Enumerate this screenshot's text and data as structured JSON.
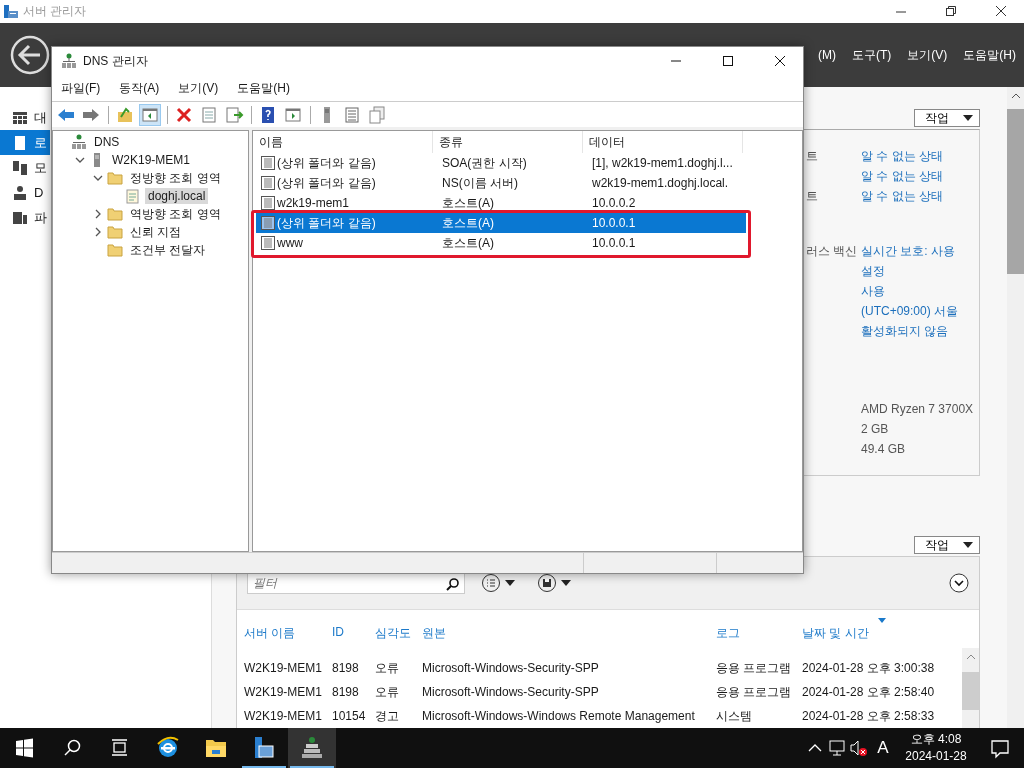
{
  "server_manager": {
    "title": "서버 관리자",
    "menu": [
      "(M)",
      "도구(T)",
      "보기(V)",
      "도움말(H)"
    ],
    "nav": [
      {
        "label": "대",
        "kind": "dashboard",
        "selected": false
      },
      {
        "label": "로",
        "kind": "local",
        "selected": true
      },
      {
        "label": "모",
        "kind": "all",
        "selected": false
      },
      {
        "label": "D",
        "kind": "dns",
        "selected": false
      },
      {
        "label": "파",
        "kind": "files",
        "selected": false
      }
    ],
    "properties": {
      "tasks_button": "작업",
      "groups": [
        [
          {
            "label": "트",
            "value": "알 수 없는 상태",
            "kind": "link"
          },
          {
            "value": "알 수 없는 상태",
            "kind": "link"
          },
          {
            "label": "트",
            "value": "알 수 없는 상태",
            "kind": "link"
          }
        ],
        [
          {
            "label": "러스 백신",
            "value": "실시간 보호: 사용",
            "kind": "link"
          },
          {
            "value": "설정",
            "kind": "link"
          },
          {
            "value": "사용",
            "kind": "link"
          },
          {
            "value": "(UTC+09:00) 서울",
            "kind": "link"
          },
          {
            "value": "활성화되지 않음",
            "kind": "link"
          }
        ],
        [
          {
            "value": "AMD Ryzen 7 3700X",
            "kind": "text"
          },
          {
            "value": "2 GB",
            "kind": "text"
          },
          {
            "value": "49.4 GB",
            "kind": "text"
          }
        ]
      ]
    },
    "events": {
      "tasks_button": "작업",
      "filter": {
        "placeholder": "필터"
      },
      "columns": [
        {
          "label": "서버 이름",
          "sorted": false
        },
        {
          "label": "ID",
          "sorted": false
        },
        {
          "label": "심각도",
          "sorted": false
        },
        {
          "label": "원본",
          "sorted": false
        },
        {
          "label": "로그",
          "sorted": false
        },
        {
          "label": "날짜 및 시간",
          "sorted": true
        }
      ],
      "rows": [
        [
          "W2K19-MEM1",
          "8198",
          "오류",
          "Microsoft-Windows-Security-SPP",
          "응용 프로그램",
          "2024-01-28 오후 3:00:38"
        ],
        [
          "W2K19-MEM1",
          "8198",
          "오류",
          "Microsoft-Windows-Security-SPP",
          "응용 프로그램",
          "2024-01-28 오후 2:58:40"
        ],
        [
          "W2K19-MEM1",
          "10154",
          "경고",
          "Microsoft-Windows-Windows Remote Management",
          "시스템",
          "2024-01-28 오후 2:58:33"
        ]
      ]
    }
  },
  "dns_manager": {
    "title": "DNS 관리자",
    "menu": [
      "파일(F)",
      "동작(A)",
      "보기(V)",
      "도움말(H)"
    ],
    "toolbar": [
      {
        "kind": "back",
        "pressed": false
      },
      {
        "kind": "forward",
        "pressed": false
      },
      {
        "kind": "separator"
      },
      {
        "kind": "up",
        "pressed": false
      },
      {
        "kind": "tree",
        "pressed": true
      },
      {
        "kind": "separator"
      },
      {
        "kind": "delete",
        "pressed": false
      },
      {
        "kind": "properties",
        "pressed": false
      },
      {
        "kind": "export",
        "pressed": false
      },
      {
        "kind": "separator"
      },
      {
        "kind": "help",
        "pressed": false
      },
      {
        "kind": "console",
        "pressed": false
      },
      {
        "kind": "separator"
      },
      {
        "kind": "server",
        "pressed": false
      },
      {
        "kind": "list",
        "pressed": false
      },
      {
        "kind": "copy",
        "pressed": false
      }
    ],
    "tree": [
      {
        "label": "DNS",
        "kind": "dns",
        "selected": false,
        "children": [
          {
            "label": "W2K19-MEM1",
            "kind": "server",
            "selected": false,
            "expanded": true,
            "children": [
              {
                "label": "정방향 조회 영역",
                "kind": "folder",
                "selected": false,
                "expanded": true,
                "children": [
                  {
                    "label": "doghj.local",
                    "kind": "zone",
                    "selected": true
                  }
                ]
              },
              {
                "label": "역방향 조회 영역",
                "kind": "folder",
                "selected": false,
                "expanded": false
              },
              {
                "label": "신뢰 지점",
                "kind": "folder",
                "selected": false,
                "expanded": false
              },
              {
                "label": "조건부 전달자",
                "kind": "folder",
                "selected": false
              }
            ]
          }
        ]
      }
    ],
    "columns": [
      "이름",
      "종류",
      "데이터"
    ],
    "records": [
      {
        "name": "(상위 폴더와 같음)",
        "type": "SOA(권한 시작)",
        "data": "[1], w2k19-mem1.doghj.l...",
        "selected": false,
        "highlighted": false
      },
      {
        "name": "(상위 폴더와 같음)",
        "type": "NS(이름 서버)",
        "data": "w2k19-mem1.doghj.local.",
        "selected": false,
        "highlighted": false
      },
      {
        "name": "w2k19-mem1",
        "type": "호스트(A)",
        "data": "10.0.0.2",
        "selected": false,
        "highlighted": false
      },
      {
        "name": "(상위 폴더와 같음)",
        "type": "호스트(A)",
        "data": "10.0.0.1",
        "selected": true,
        "highlighted": true
      },
      {
        "name": "www",
        "type": "호스트(A)",
        "data": "10.0.0.1",
        "selected": false,
        "highlighted": true
      }
    ]
  },
  "taskbar": {
    "apps": [
      {
        "kind": "browser",
        "running": false,
        "selected": false
      },
      {
        "kind": "explorer",
        "running": false,
        "selected": false
      },
      {
        "kind": "server-manager",
        "running": true,
        "selected": false
      },
      {
        "kind": "dns",
        "running": true,
        "selected": true
      }
    ],
    "input_method": "A",
    "time": "오후 4:08",
    "date": "2024-01-28"
  }
}
